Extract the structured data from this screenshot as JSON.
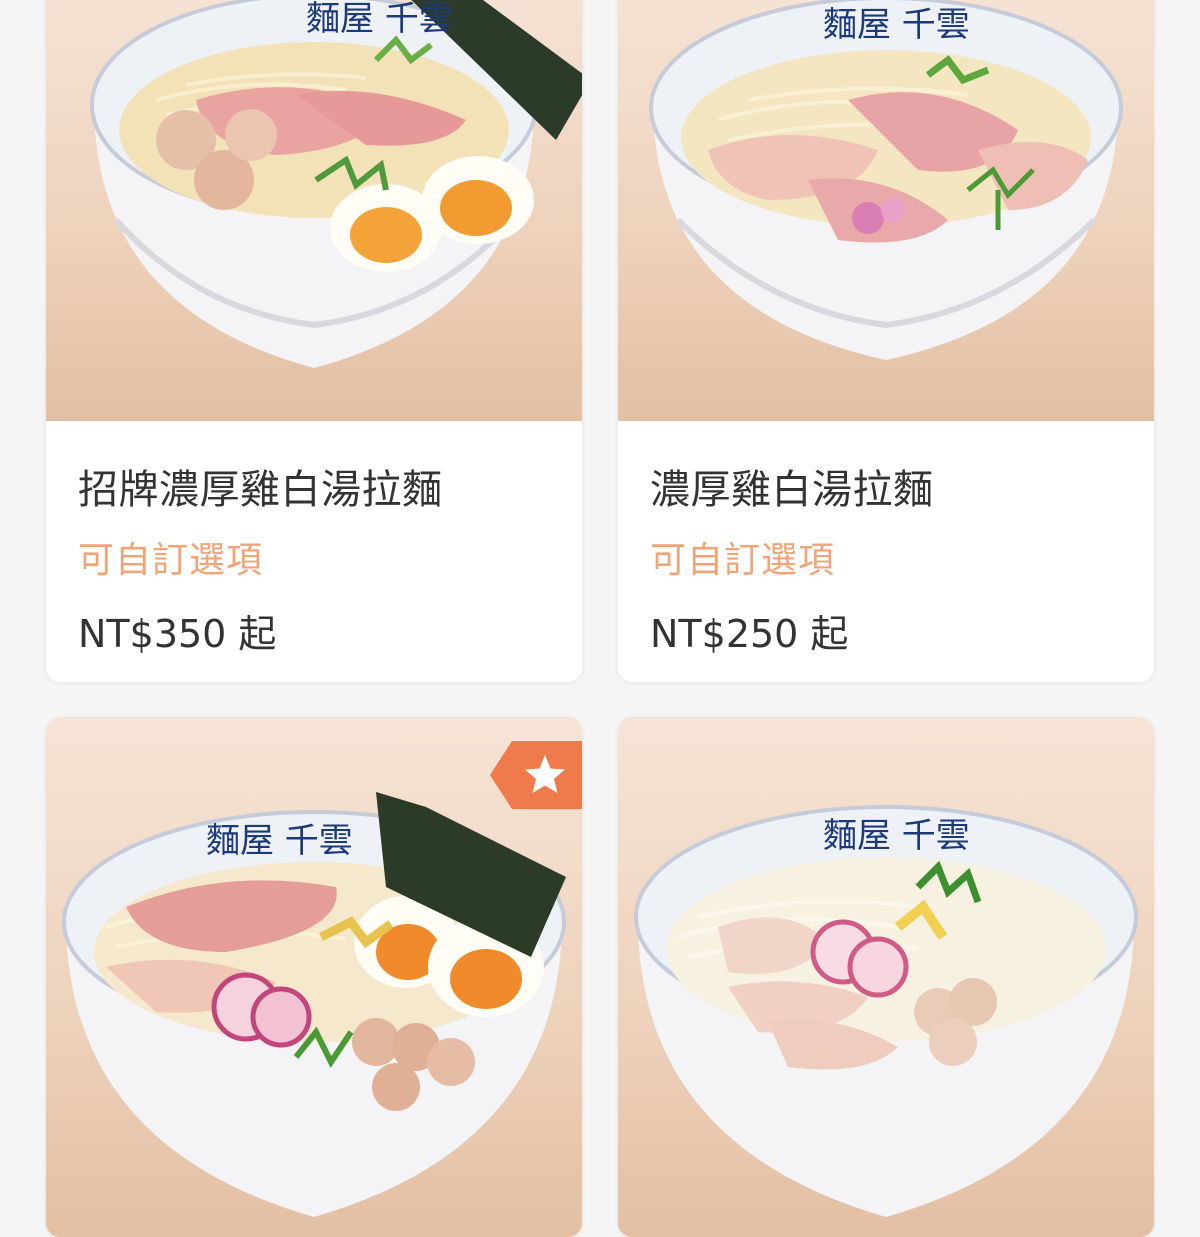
{
  "colors": {
    "accent": "#ef7a4b",
    "option_text": "#f0a478",
    "title_text": "#333333"
  },
  "menu_items": [
    {
      "title": "招牌濃厚雞白湯拉麵",
      "option_label": "可自訂選項",
      "price": "NT$350 起",
      "bowl_brand": "麵屋 千雲",
      "badge_icon": "star-icon"
    },
    {
      "title": "濃厚雞白湯拉麵",
      "option_label": "可自訂選項",
      "price": "NT$250 起",
      "bowl_brand": "麵屋 千雲"
    },
    {
      "bowl_brand": "麵屋 千雲",
      "badge_icon": "star-icon"
    },
    {
      "bowl_brand": "麵屋 千雲"
    }
  ]
}
